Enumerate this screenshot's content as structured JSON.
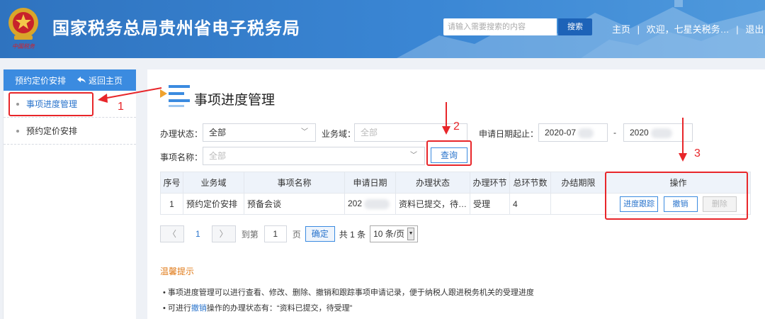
{
  "header": {
    "site_title": "国家税务总局贵州省电子税务局",
    "search_placeholder": "请输入需要搜索的内容",
    "search_button": "搜索",
    "nav_home": "主页",
    "nav_sep": "|",
    "nav_welcome": "欢迎，七星关税务…",
    "nav_exit": "退出",
    "emblem_text": "中国税务"
  },
  "sidebar": {
    "title": "预约定价安排",
    "back": "返回主页",
    "items": [
      {
        "label": "事项进度管理"
      },
      {
        "label": "预约定价安排"
      }
    ]
  },
  "main": {
    "page_title": "事项进度管理",
    "filters": {
      "status_label": "办理状态：",
      "status_value": "全部",
      "domain_label": "业务域：",
      "domain_placeholder": "全部",
      "date_label": "申请日期起止：",
      "date_start": "2020-07",
      "date_sep": "-",
      "date_end": "2020",
      "item_label": "事项名称：",
      "item_placeholder": "全部",
      "query_button": "查询"
    },
    "table": {
      "headers": [
        "序号",
        "业务域",
        "事项名称",
        "申请日期",
        "办理状态",
        "办理环节",
        "总环节数",
        "办结期限",
        "操作"
      ],
      "rows": [
        {
          "index": "1",
          "domain": "预约定价安排",
          "name": "预备会谈",
          "date": "202",
          "status": "资料已提交，待…",
          "step": "受理",
          "total": "4",
          "deadline": ""
        }
      ],
      "actions": [
        "进度跟踪",
        "撤销",
        "删除"
      ]
    },
    "pager": {
      "current": "1",
      "goto_label": "到第",
      "page_input": "1",
      "page_unit": "页",
      "confirm": "确定",
      "total": "共 1 条",
      "page_size": "10 条/页"
    },
    "tips": {
      "title": "温馨提示",
      "line1": "事项进度管理可以进行查看、修改、删除、撤销和跟踪事项申请记录，便于纳税人跟进税务机关的受理进度",
      "line2_pre": "可进行",
      "line2_link": "撤销",
      "line2_post": "操作的办理状态有：“资料已提交，待受理”"
    }
  },
  "annotations": {
    "n1": "1",
    "n2": "2",
    "n3": "3"
  },
  "colors": {
    "accent": "#3b8be0",
    "annotation": "#e8262a",
    "header": "#2f73bf",
    "tip_title": "#e07b1a"
  }
}
